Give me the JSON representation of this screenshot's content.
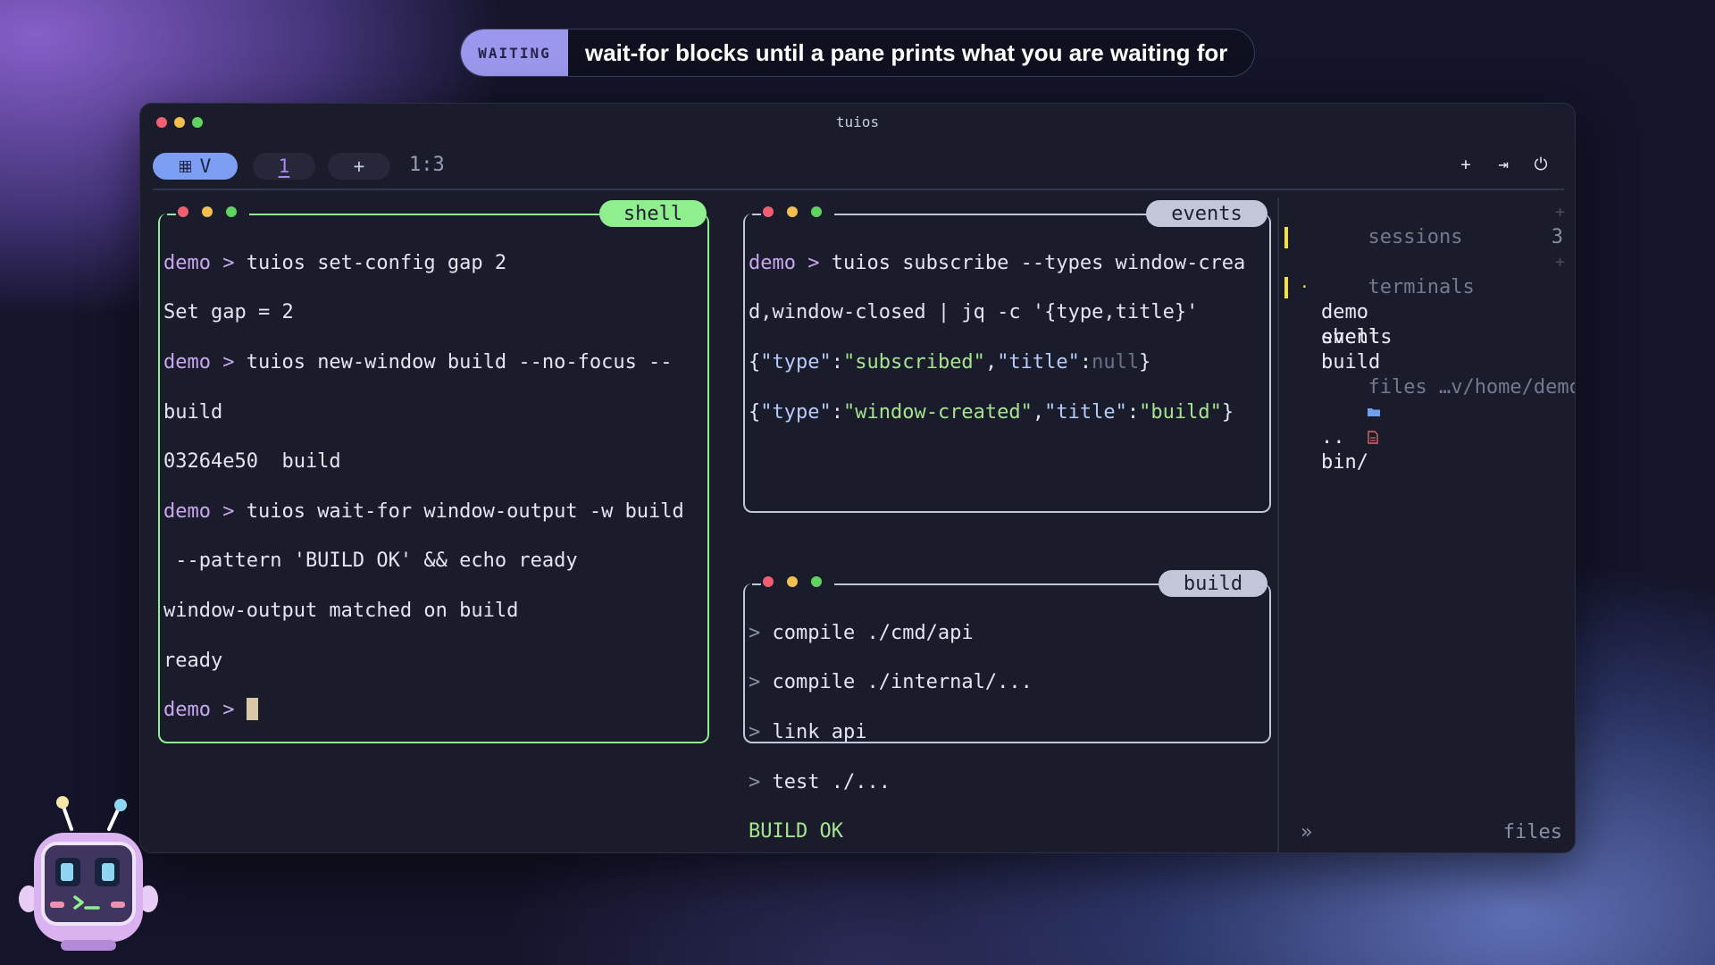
{
  "banner": {
    "badge": "WAITING",
    "caption": "wait-for blocks until a pane prints what you are waiting for"
  },
  "window": {
    "title": "tuios",
    "traffic_lights": [
      "#ef5f6f",
      "#f4bf4f",
      "#5fd35f"
    ]
  },
  "topbar": {
    "mode_icon": "grid-icon",
    "mode_label": "V",
    "tab_label": "1",
    "add_label": "+",
    "layout_label": "1:3",
    "icons": {
      "new_window": "+",
      "detach": "⇥",
      "power": "⏻"
    }
  },
  "panes": {
    "shell": {
      "title": "shell",
      "accent": "#8fef8f",
      "lines": [
        {
          "prompt": "demo > ",
          "text": "tuios set-config gap 2"
        },
        {
          "prompt": "",
          "text": "Set gap = 2"
        },
        {
          "prompt": "demo > ",
          "text": "tuios new-window build --no-focus --"
        },
        {
          "prompt": "",
          "text": "build"
        },
        {
          "prompt": "",
          "text": "03264e50  build"
        },
        {
          "prompt": "demo > ",
          "text": "tuios wait-for window-output -w build"
        },
        {
          "prompt": "",
          "text": " --pattern 'BUILD OK' && echo ready"
        },
        {
          "prompt": "",
          "text": "window-output matched on build"
        },
        {
          "prompt": "",
          "text": "ready"
        },
        {
          "prompt": "demo > ",
          "text": ""
        }
      ]
    },
    "events": {
      "title": "events",
      "command_prompt": "demo > ",
      "command_line1": "tuios subscribe --types window-crea",
      "command_line2": "d,window-closed | jq -c '{type,title}'",
      "json_lines": [
        {
          "key1": "\"type\"",
          "val1": "\"subscribed\"",
          "key2": "\"title\"",
          "val2": "null"
        },
        {
          "key1": "\"type\"",
          "val1": "\"window-created\"",
          "key2": "\"title\"",
          "val2": "\"build\""
        }
      ]
    },
    "build": {
      "title": "build",
      "steps": [
        {
          "marker": "> ",
          "text": "compile ./cmd/api"
        },
        {
          "marker": "> ",
          "text": "compile ./internal/..."
        },
        {
          "marker": "> ",
          "text": "link api"
        },
        {
          "marker": "> ",
          "text": "test ./..."
        }
      ],
      "result": "BUILD OK"
    }
  },
  "sidebar": {
    "sessions_label": "sessions",
    "sessions_add": "+",
    "session": {
      "bullet": "·",
      "name": "demo",
      "count": "3"
    },
    "terminals_label": "terminals",
    "terminals_add": "+",
    "terminals": [
      "shell",
      "events",
      "build"
    ],
    "files_header": "files …v/home/demo cd",
    "files": [
      {
        "icon": "folder-icon",
        "name": ".."
      },
      {
        "icon": "file-icon",
        "name": "bin/"
      }
    ],
    "footer_expand": "»",
    "footer_label": "files"
  }
}
